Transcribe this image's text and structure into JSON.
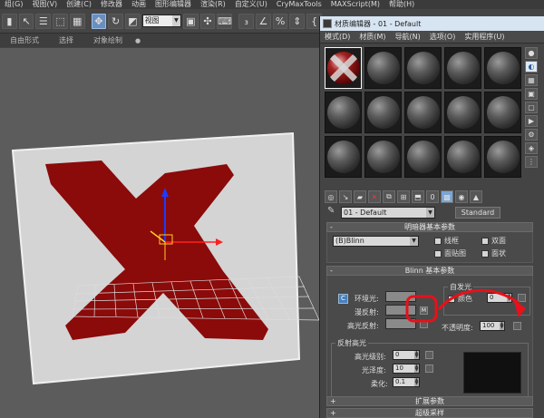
{
  "menubar": [
    "组(G)",
    "视图(V)",
    "创建(C)",
    "修改器",
    "动画",
    "图形编辑器",
    "渲染(R)",
    "自定义(U)",
    "CryMaxTools",
    "MAXScript(M)",
    "帮助(H)"
  ],
  "toolbar": {
    "view_select": "视图"
  },
  "ribbon": [
    "自由形式",
    "选择",
    "对象绘制",
    "●"
  ],
  "material_editor": {
    "title": "材质编辑器 - 01 - Default",
    "menu": [
      "模式(D)",
      "材质(M)",
      "导航(N)",
      "选项(O)",
      "实用程序(U)"
    ],
    "material_name": "01 - Default",
    "material_type": "Standard",
    "shader_rollout": {
      "title": "明暗器基本参数",
      "shader": "(B)Blinn",
      "wire": "线框",
      "two_sided": "双面",
      "face_map": "面贴图",
      "faceted": "面状"
    },
    "blinn_rollout": {
      "title": "Blinn 基本参数",
      "self_illum_group": "自发光",
      "color_label": "颜色",
      "self_illum_value": "0",
      "ambient": "环境光:",
      "diffuse": "漫反射:",
      "specular": "高光反射:",
      "opacity_label": "不透明度:",
      "opacity_value": "100",
      "diffuse_map_button": "M",
      "lock_button": "C",
      "spec_group": "反射高光",
      "spec_level_label": "高光级别:",
      "spec_level": "0",
      "gloss_label": "光泽度:",
      "gloss": "10",
      "soften_label": "柔化:",
      "soften": "0.1"
    },
    "extended_rollout": "扩展参数",
    "supersampling_rollout": "超级采样"
  },
  "colors": {
    "brand_red": "#8b0a0a",
    "annotation_red": "#e8101a",
    "title_bar": "#d7e4f2"
  }
}
